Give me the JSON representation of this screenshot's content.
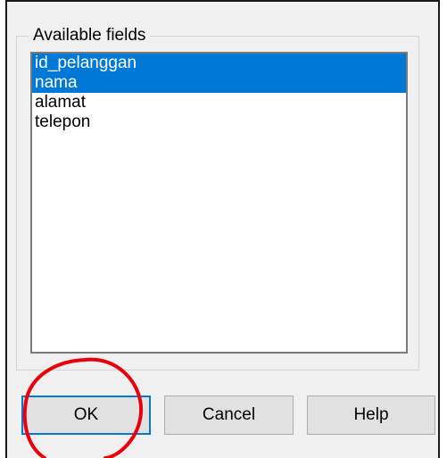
{
  "dialog": {
    "group_title": "Available fields",
    "fields": [
      {
        "label": "id_pelanggan",
        "selected": true
      },
      {
        "label": "nama",
        "selected": true
      },
      {
        "label": "alamat",
        "selected": false
      },
      {
        "label": "telepon",
        "selected": false
      }
    ],
    "buttons": {
      "ok": "OK",
      "cancel": "Cancel",
      "help": "Help"
    }
  },
  "colors": {
    "selection": "#0078d7",
    "annotation_circle": "#e8000b"
  }
}
